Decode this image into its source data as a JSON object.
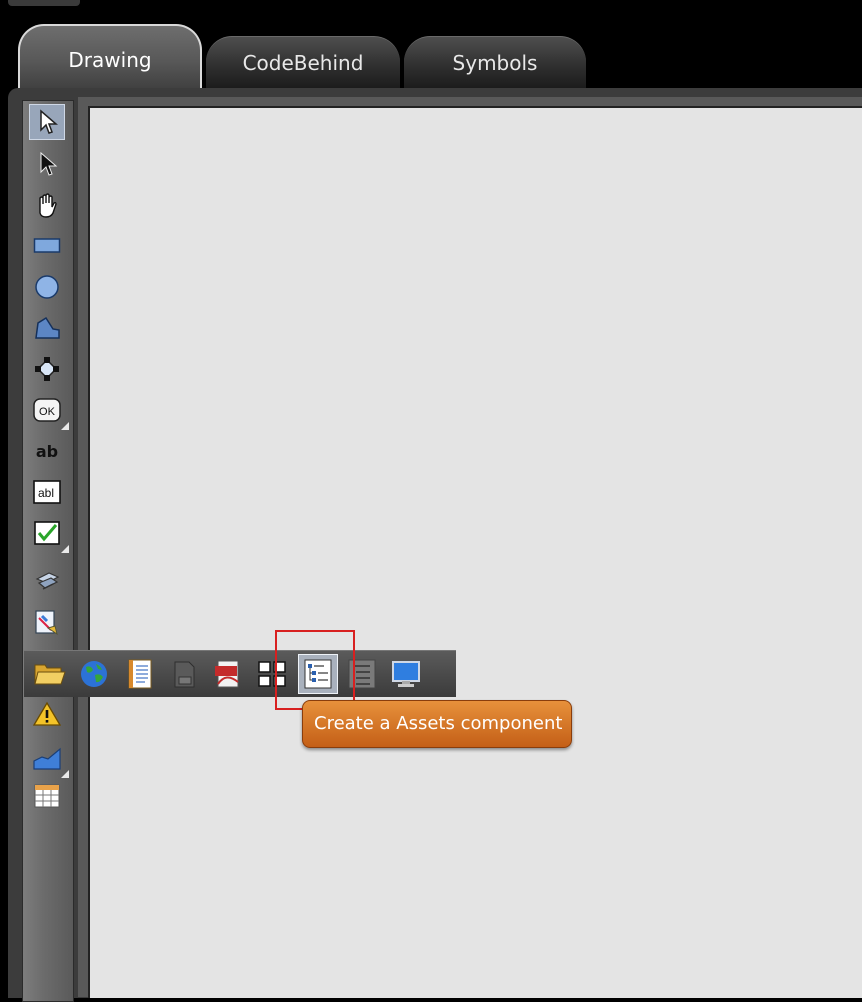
{
  "tabs": [
    {
      "label": "Drawing",
      "active": true
    },
    {
      "label": "CodeBehind",
      "active": false
    },
    {
      "label": "Symbols",
      "active": false
    }
  ],
  "toolbar": {
    "tools": [
      {
        "icon": "pointer-select-icon",
        "selected": true
      },
      {
        "icon": "pointer-icon"
      },
      {
        "icon": "hand-pan-icon"
      },
      {
        "icon": "rectangle-icon"
      },
      {
        "icon": "ellipse-icon"
      },
      {
        "icon": "polygon-icon"
      },
      {
        "icon": "node-edit-icon"
      },
      {
        "icon": "button-control-icon",
        "label": "OK"
      },
      {
        "icon": "text-label-icon",
        "label": "ab"
      },
      {
        "icon": "textbox-control-icon",
        "label": "abl"
      },
      {
        "icon": "checkbox-control-icon"
      },
      {
        "icon": "plugin-icon"
      },
      {
        "icon": "image-control-icon"
      },
      {
        "icon": "alarm-warning-icon"
      },
      {
        "icon": "trend-chart-icon"
      },
      {
        "icon": "grid-table-icon"
      }
    ]
  },
  "popup": {
    "items": [
      {
        "icon": "open-folder-icon"
      },
      {
        "icon": "globe-icon"
      },
      {
        "icon": "notebook-icon"
      },
      {
        "icon": "report-icon"
      },
      {
        "icon": "pdf-viewer-icon"
      },
      {
        "icon": "four-squares-icon"
      },
      {
        "icon": "assets-tree-icon",
        "hover": true
      },
      {
        "icon": "assets-list-icon"
      },
      {
        "icon": "monitor-icon"
      }
    ]
  },
  "tooltip": {
    "text": "Create a Assets component"
  },
  "colors": {
    "tooltip": "#d9782a",
    "canvas": "#e4e4e4",
    "highlight": "#d82020",
    "selection": "#98a6ba"
  }
}
